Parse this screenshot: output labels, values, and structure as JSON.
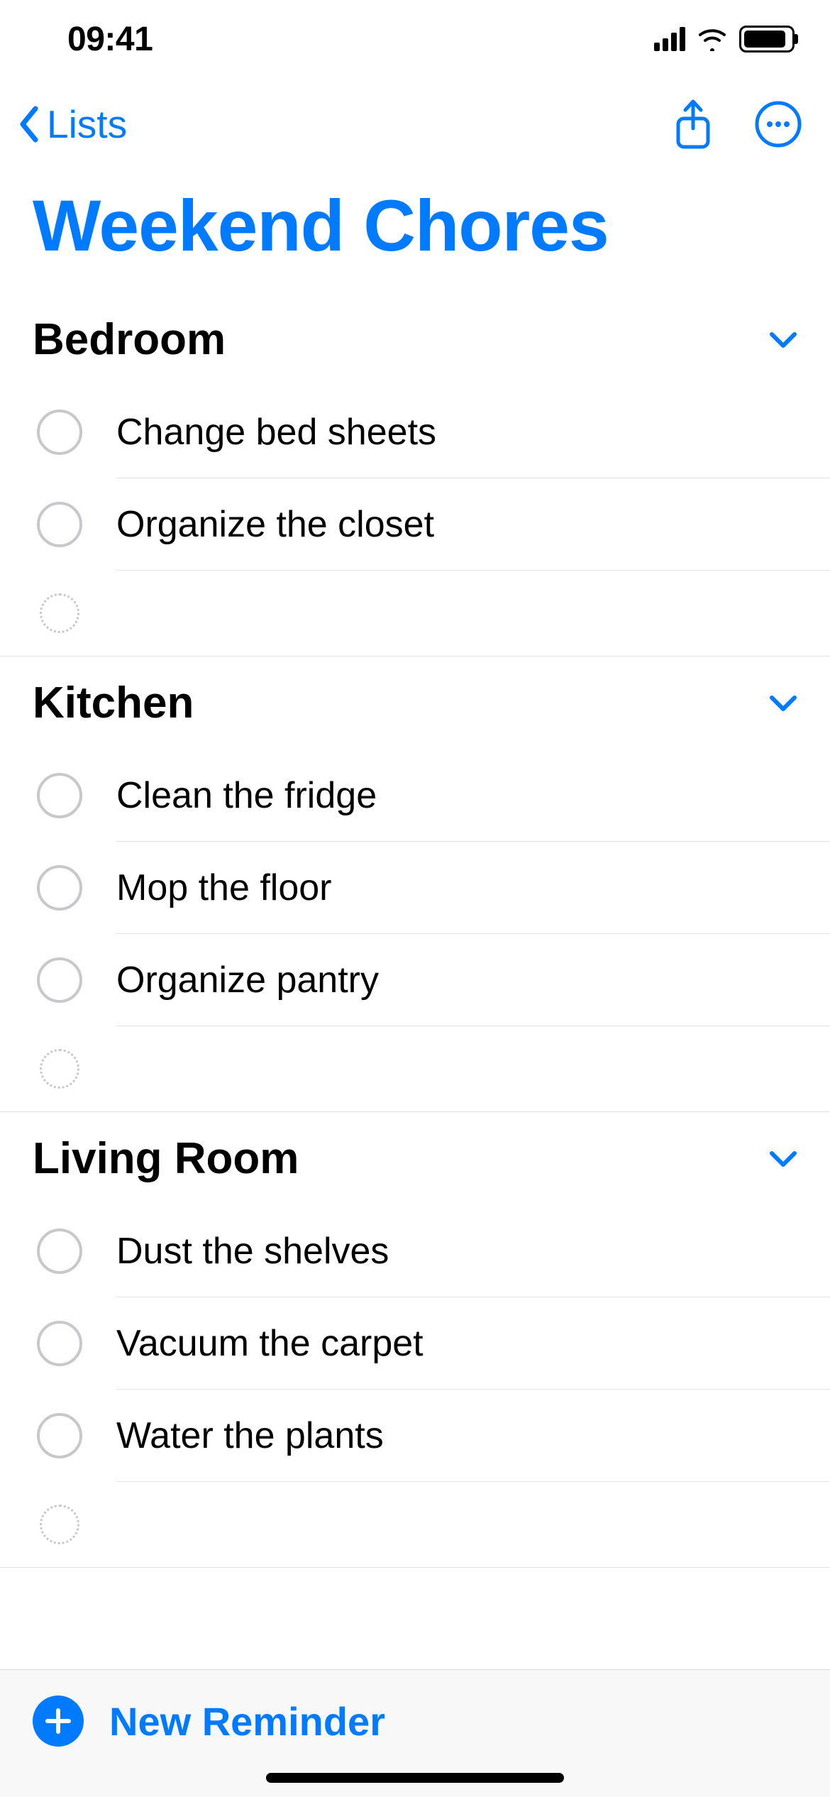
{
  "status": {
    "time": "09:41"
  },
  "nav": {
    "back_label": "Lists"
  },
  "title": "Weekend Chores",
  "sections": [
    {
      "title": "Bedroom",
      "items": [
        {
          "label": "Change bed sheets"
        },
        {
          "label": "Organize the closet"
        }
      ]
    },
    {
      "title": "Kitchen",
      "items": [
        {
          "label": "Clean the fridge"
        },
        {
          "label": "Mop the floor"
        },
        {
          "label": "Organize pantry"
        }
      ]
    },
    {
      "title": "Living Room",
      "items": [
        {
          "label": "Dust the shelves"
        },
        {
          "label": "Vacuum the carpet"
        },
        {
          "label": "Water the plants"
        }
      ]
    }
  ],
  "bottom": {
    "new_reminder_label": "New Reminder"
  },
  "colors": {
    "accent": "#007aff"
  }
}
